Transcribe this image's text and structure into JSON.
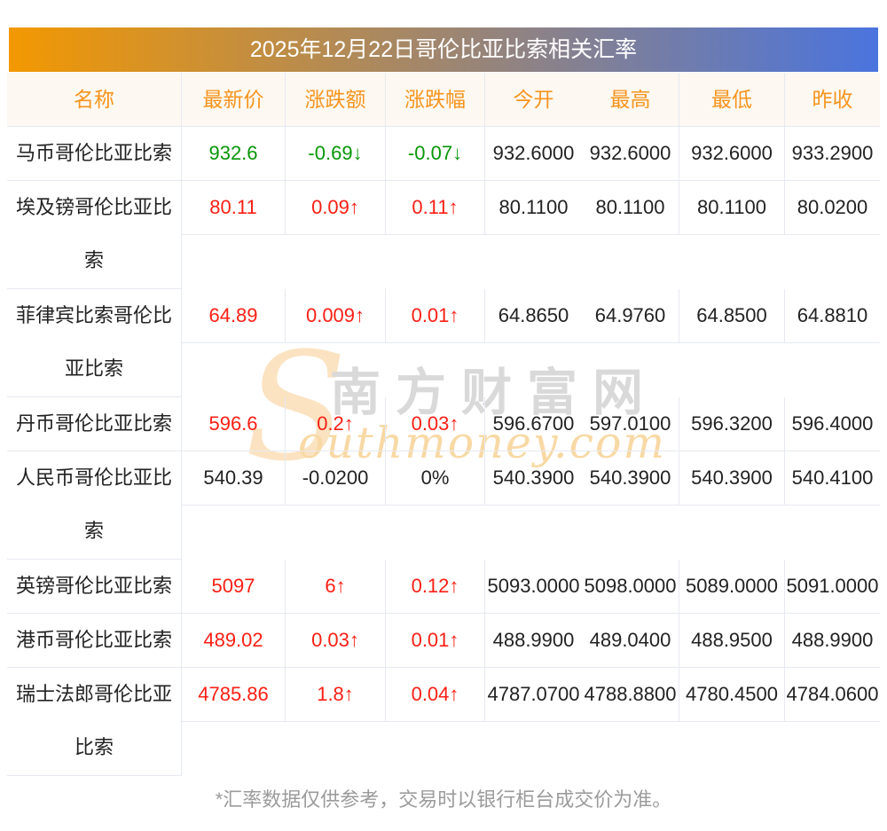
{
  "page": {
    "title": "2025年12月22日哥伦比亚比索相关汇率",
    "footnote": "*汇率数据仅供参考，交易时以银行柜台成交价为准。"
  },
  "watermark": {
    "initial": "S",
    "cn": "南方财富网",
    "en": "outhmoney.com"
  },
  "theme": {
    "banner_from": "#f39801",
    "banner_to": "#4a74de",
    "header_bg": "#fdf8f1",
    "header_text": "#f7941e",
    "border": "#e6e9f1",
    "text": "#222222",
    "up": "#fa1f14",
    "down": "#089608",
    "flat": "#222222",
    "footer_text": "#9b9b9b"
  },
  "table": {
    "columns": [
      "名称",
      "最新价",
      "涨跌额",
      "涨跌幅",
      "今开",
      "最高",
      "最低",
      "昨收"
    ],
    "rows": [
      {
        "name": "马币哥伦比亚比索",
        "latest": "932.6",
        "change": "-0.69↓",
        "pct": "-0.07↓",
        "open": "932.6000",
        "high": "932.6000",
        "low": "932.6000",
        "prev": "933.2900",
        "trend": "down"
      },
      {
        "name": "埃及镑哥伦比亚比索",
        "latest": "80.11",
        "change": "0.09↑",
        "pct": "0.11↑",
        "open": "80.1100",
        "high": "80.1100",
        "low": "80.1100",
        "prev": "80.0200",
        "trend": "up"
      },
      {
        "name": "菲律宾比索哥伦比亚比索",
        "latest": "64.89",
        "change": "0.009↑",
        "pct": "0.01↑",
        "open": "64.8650",
        "high": "64.9760",
        "low": "64.8500",
        "prev": "64.8810",
        "trend": "up"
      },
      {
        "name": "丹币哥伦比亚比索",
        "latest": "596.6",
        "change": "0.2↑",
        "pct": "0.03↑",
        "open": "596.6700",
        "high": "597.0100",
        "low": "596.3200",
        "prev": "596.4000",
        "trend": "up"
      },
      {
        "name": "人民币哥伦比亚比索",
        "latest": "540.39",
        "change": "-0.0200",
        "pct": "0%",
        "open": "540.3900",
        "high": "540.3900",
        "low": "540.3900",
        "prev": "540.4100",
        "trend": "flat"
      },
      {
        "name": "英镑哥伦比亚比索",
        "latest": "5097",
        "change": "6↑",
        "pct": "0.12↑",
        "open": "5093.0000",
        "high": "5098.0000",
        "low": "5089.0000",
        "prev": "5091.0000",
        "trend": "up"
      },
      {
        "name": "港币哥伦比亚比索",
        "latest": "489.02",
        "change": "0.03↑",
        "pct": "0.01↑",
        "open": "488.9900",
        "high": "489.0400",
        "low": "488.9500",
        "prev": "488.9900",
        "trend": "up"
      },
      {
        "name": "瑞士法郎哥伦比亚比索",
        "latest": "4785.86",
        "change": "1.8↑",
        "pct": "0.04↑",
        "open": "4787.0700",
        "high": "4788.8800",
        "low": "4780.4500",
        "prev": "4784.0600",
        "trend": "up"
      }
    ]
  }
}
